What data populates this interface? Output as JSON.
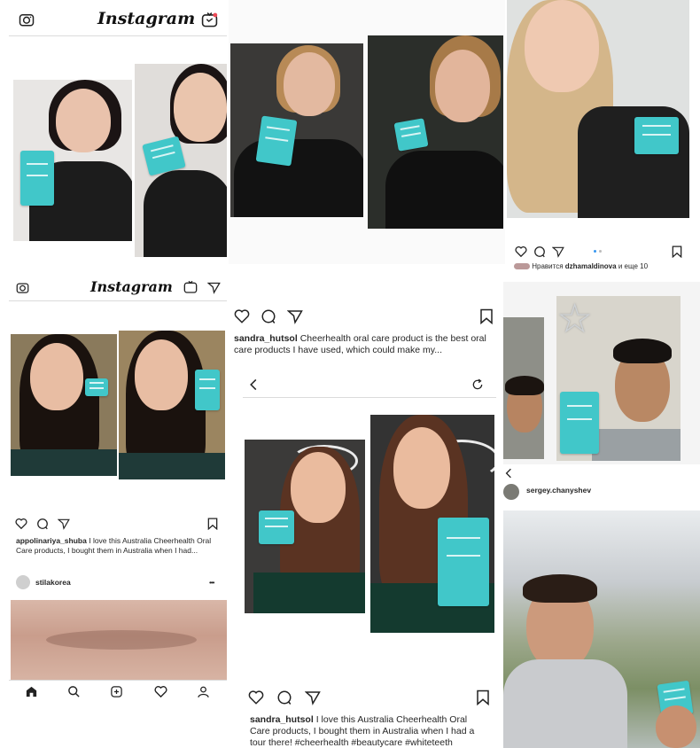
{
  "brand": {
    "logo_text": "Instagram",
    "box_color": "#41c7c9"
  },
  "panel_topleft": {
    "logo": "Instagram"
  },
  "panel_topright": {
    "liked_by_prefix": "Нравится",
    "liked_by_user": "dzhamaldinova",
    "liked_by_suffix": "и еще 10"
  },
  "panel_midleft": {
    "logo": "Instagram",
    "caption_user": "appolinariya_shuba",
    "caption_text": "I love this Australia Cheerhealth Oral Care products, I bought them in Australia when I had...",
    "next_user": "stilakorea",
    "more_dots": "•••"
  },
  "panel_center": {
    "caption_user": "sandra_hutsol",
    "caption_text": "Cheerhealth oral care product is the best oral care products I have used, which could make my..."
  },
  "panel_bottom_center": {
    "caption_user": "sandra_hutsol",
    "caption_text": "I love this Australia Cheerhealth Oral Care products, I bought them in Australia when I had a tour there! #cheerhealth #beautycare #whiteteeth"
  },
  "panel_right": {
    "profile_user": "sergey.chanyshev"
  },
  "icons": {
    "camera": "camera-icon",
    "igtv": "igtv-icon",
    "direct": "direct-message-icon",
    "heart": "heart-icon",
    "comment": "comment-icon",
    "share": "share-icon",
    "bookmark": "bookmark-icon",
    "back": "back-chevron-icon",
    "refresh": "refresh-icon",
    "home": "home-icon",
    "search": "search-icon",
    "add": "add-post-icon",
    "activity": "activity-heart-icon",
    "profile": "profile-icon"
  }
}
